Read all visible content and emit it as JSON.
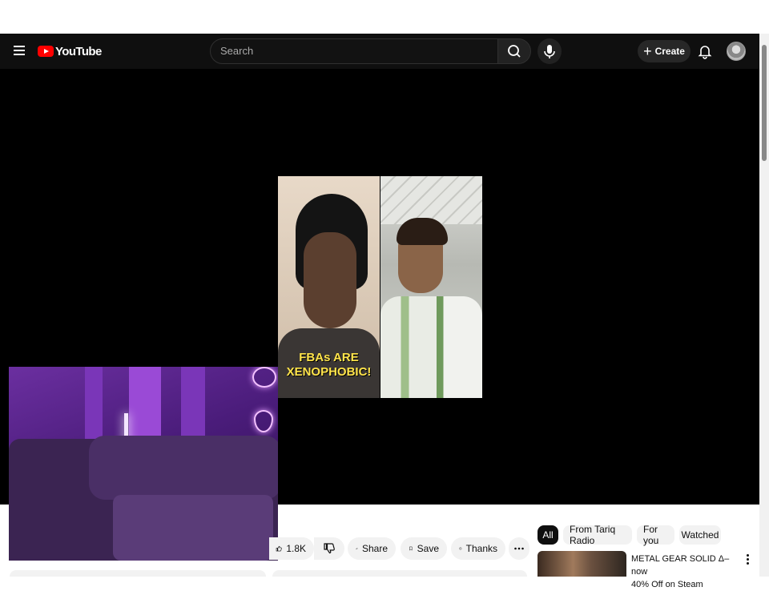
{
  "header": {
    "logo_text": "YouTube",
    "search_placeholder": "Search",
    "create_label": "Create"
  },
  "video": {
    "caption_line1": "FBAs ARE",
    "caption_line2": "XENOPHOBIC!"
  },
  "actions": {
    "like_count": "1.8K",
    "share_label": "Share",
    "save_label": "Save",
    "thanks_label": "Thanks"
  },
  "chips": [
    "All",
    "From Tariq Radio",
    "For you",
    "Watched"
  ],
  "recommendation": {
    "title_line1": "METAL GEAR SOLID Δ– now",
    "title_line2": "40% Off on Steam"
  },
  "icons": {
    "menu": "hamburger-icon",
    "search": "search-icon",
    "mic": "microphone-icon",
    "notifications": "bell-icon",
    "like": "thumbs-up-icon",
    "dislike": "thumbs-down-icon",
    "share": "share-arrow-icon",
    "save": "bookmark-icon",
    "thanks": "super-thanks-icon",
    "more": "more-horizontal-icon"
  },
  "colors": {
    "brand_red": "#ff0000",
    "masthead": "#0f0f0f"
  }
}
